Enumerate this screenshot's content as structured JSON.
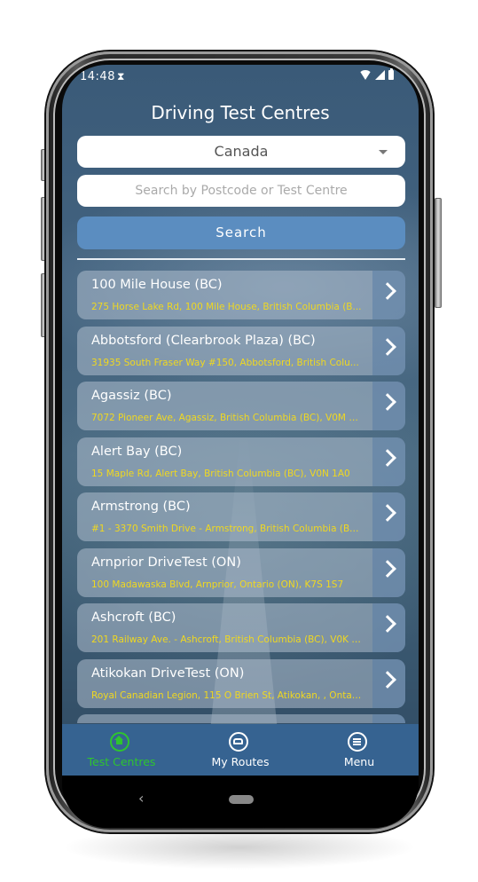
{
  "status_bar": {
    "time": "14:48",
    "hourglass_icon": "hourglass-icon",
    "icons": [
      "wifi-icon",
      "signal-icon",
      "battery-icon"
    ]
  },
  "header": {
    "title": "Driving Test Centres"
  },
  "country_select": {
    "selected": "Canada"
  },
  "search": {
    "placeholder": "Search by Postcode or Test Centre",
    "value": "",
    "button_label": "Search"
  },
  "centres": [
    {
      "name": "100 Mile House (BC)",
      "address": "275 Horse Lake Rd, 100 Mile House, British Columbia (B..."
    },
    {
      "name": "Abbotsford (Clearbrook Plaza) (BC)",
      "address": "31935 South Fraser Way #150, Abbotsford, British Colu..."
    },
    {
      "name": "Agassiz (BC)",
      "address": "7072 Pioneer Ave, Agassiz, British Columbia (BC), V0M 1..."
    },
    {
      "name": "Alert Bay (BC)",
      "address": "15 Maple Rd,  Alert Bay, British Columbia (BC), V0N 1A0"
    },
    {
      "name": "Armstrong (BC)",
      "address": "#1 - 3370 Smith Drive - Armstrong, British Columbia (BC..."
    },
    {
      "name": "Arnprior DriveTest (ON)",
      "address": "100 Madawaska Blvd, Arnprior, Ontario (ON), K7S 1S7"
    },
    {
      "name": "Ashcroft (BC)",
      "address": "201 Railway Ave. - Ashcroft, British Columbia (BC), V0K 1..."
    },
    {
      "name": "Atikokan DriveTest (ON)",
      "address": "Royal Canadian Legion, 115 O Brien St, Atikokan, , Ontar..."
    }
  ],
  "tab_bar": {
    "tabs": [
      {
        "label": "Test Centres",
        "icon": "home-icon",
        "active": true
      },
      {
        "label": "My Routes",
        "icon": "car-icon",
        "active": false
      },
      {
        "label": "Menu",
        "icon": "menu-icon",
        "active": false
      }
    ],
    "active_color": "#2ec52e"
  },
  "colors": {
    "accent_button": "#5b8dc0",
    "tab_bar": "#366391",
    "address_text": "#f0d820"
  }
}
